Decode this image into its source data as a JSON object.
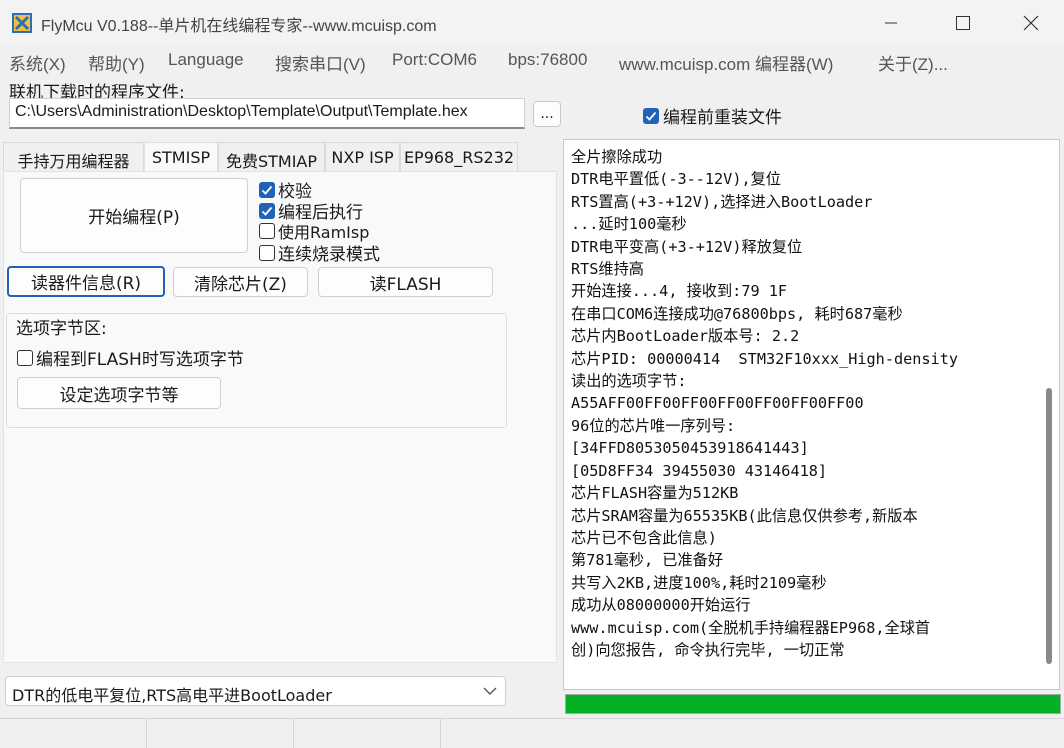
{
  "window": {
    "title": "FlyMcu V0.188--单片机在线编程专家--www.mcuisp.com"
  },
  "menu": [
    "系统(X)",
    "帮助(Y)",
    "Language",
    "搜索串口(V)",
    "Port:COM6",
    "bps:76800",
    "www.mcuisp.com 编程器(W)",
    "关于(Z)..."
  ],
  "file": {
    "label": "联机下载时的程序文件:",
    "path": "C:\\Users\\Administration\\Desktop\\Template\\Output\\Template.hex",
    "browse_label": "...",
    "reload_label": "编程前重装文件",
    "reload_checked": true
  },
  "tabs": [
    "手持万用编程器",
    "STMISP",
    "免费STMIAP",
    "NXP ISP",
    "EP968_RS232"
  ],
  "actions": {
    "start": "开始编程(P)",
    "read_info": "读器件信息(R)",
    "erase": "清除芯片(Z)",
    "read_flash": "读FLASH"
  },
  "options": {
    "verify": "校验",
    "run_after": "编程后执行",
    "use_ramisp": "使用RamIsp",
    "continuous": "连续烧录模式"
  },
  "option_bytes": {
    "group_title": "选项字节区:",
    "write_label": "编程到FLASH时写选项字节",
    "set_button": "设定选项字节等"
  },
  "reset_mode": {
    "selected": "DTR的低电平复位,RTS高电平进BootLoader"
  },
  "log": [
    "全片擦除成功",
    "DTR电平置低(-3--12V),复位",
    "RTS置高(+3-+12V),选择进入BootLoader",
    "...延时100毫秒",
    "DTR电平变高(+3-+12V)释放复位",
    "RTS维持高",
    "开始连接...4, 接收到:79 1F",
    "在串口COM6连接成功@76800bps, 耗时687毫秒",
    "芯片内BootLoader版本号: 2.2",
    "芯片PID: 00000414  STM32F10xxx_High-density",
    "读出的选项字节:",
    "A55AFF00FF00FF00FF00FF00FF00FF00",
    "96位的芯片唯一序列号:",
    "[34FFD8053050453918641443]",
    "[05D8FF34 39455030 43146418]",
    "芯片FLASH容量为512KB",
    "芯片SRAM容量为65535KB(此信息仅供参考,新版本",
    "芯片已不包含此信息)",
    "第781毫秒, 已准备好",
    "共写入2KB,进度100%,耗时2109毫秒",
    "成功从08000000开始运行",
    "www.mcuisp.com(全脱机手持编程器EP968,全球首",
    "创)向您报告, 命令执行完毕, 一切正常"
  ],
  "progress": {
    "percent": 100,
    "color": "#06b025"
  },
  "accent": "#1f62b8"
}
